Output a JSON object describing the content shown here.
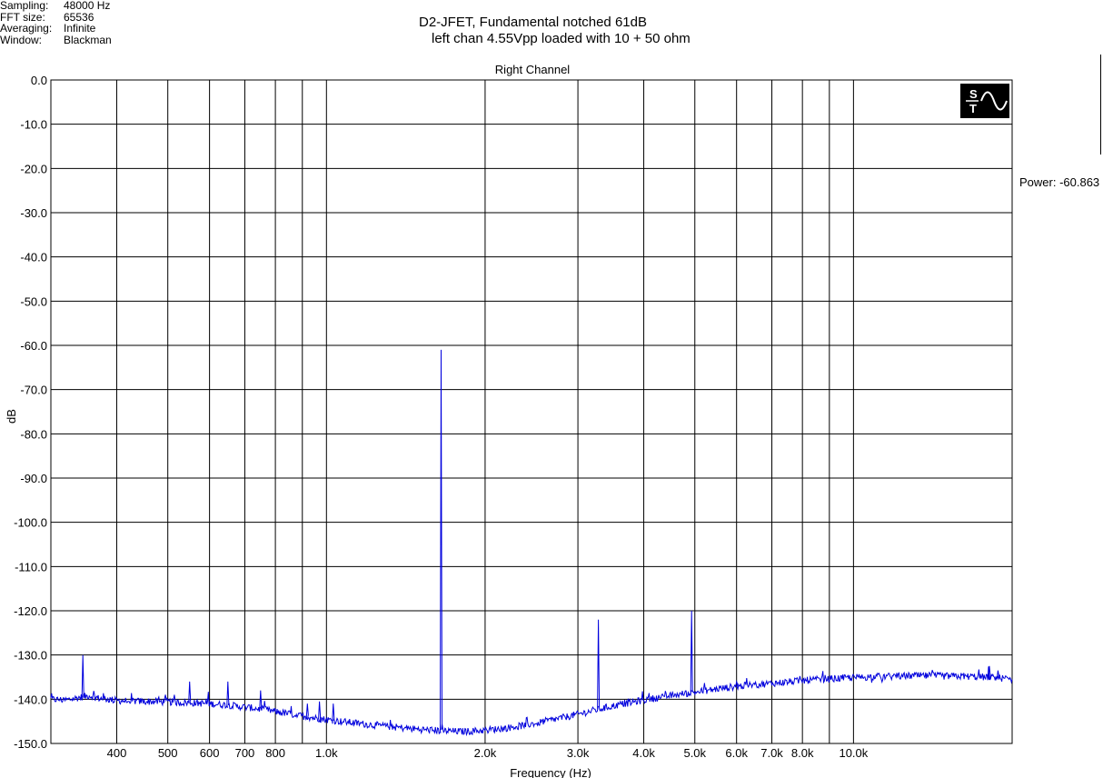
{
  "meta": {
    "rows": [
      {
        "key": "Sampling:",
        "value": "48000 Hz"
      },
      {
        "key": "FFT size:",
        "value": "65536"
      },
      {
        "key": "Averaging:",
        "value": "Infinite"
      },
      {
        "key": "Window:",
        "value": "Blackman"
      }
    ]
  },
  "header": {
    "title_line1": "D2-JFET, Fundamental notched 61dB",
    "title_line2": "left chan 4.55Vpp loaded with 10 + 50 ohm"
  },
  "power_readout": "Power: -60.863",
  "logo_text": "S T",
  "chart_data": {
    "type": "line",
    "title": "Right Channel",
    "xlabel": "Frequency (Hz)",
    "ylabel": "dB",
    "xscale": "log",
    "xlim": [
      300,
      20000
    ],
    "ylim": [
      -150,
      0
    ],
    "grid": true,
    "colors": {
      "series": "#0000dd",
      "grid": "#000000"
    },
    "y_ticks": [
      {
        "value": 0,
        "label": "0.0"
      },
      {
        "value": -10,
        "label": "-10.0"
      },
      {
        "value": -20,
        "label": "-20.0"
      },
      {
        "value": -30,
        "label": "-30.0"
      },
      {
        "value": -40,
        "label": "-40.0"
      },
      {
        "value": -50,
        "label": "-50.0"
      },
      {
        "value": -60,
        "label": "-60.0"
      },
      {
        "value": -70,
        "label": "-70.0"
      },
      {
        "value": -80,
        "label": "-80.0"
      },
      {
        "value": -90,
        "label": "-90.0"
      },
      {
        "value": -100,
        "label": "-100.0"
      },
      {
        "value": -110,
        "label": "-110.0"
      },
      {
        "value": -120,
        "label": "-120.0"
      },
      {
        "value": -130,
        "label": "-130.0"
      },
      {
        "value": -140,
        "label": "-140.0"
      },
      {
        "value": -150,
        "label": "-150.0"
      }
    ],
    "x_ticks": [
      {
        "value": 400,
        "label": "400"
      },
      {
        "value": 500,
        "label": "500"
      },
      {
        "value": 600,
        "label": "600"
      },
      {
        "value": 700,
        "label": "700"
      },
      {
        "value": 800,
        "label": "800"
      },
      {
        "value": 1000,
        "label": "1.0k"
      },
      {
        "value": 2000,
        "label": "2.0k"
      },
      {
        "value": 3000,
        "label": "3.0k"
      },
      {
        "value": 4000,
        "label": "4.0k"
      },
      {
        "value": 5000,
        "label": "5.0k"
      },
      {
        "value": 6000,
        "label": "6.0k"
      },
      {
        "value": 7000,
        "label": "7.0k"
      },
      {
        "value": 8000,
        "label": "8.0k"
      },
      {
        "value": 10000,
        "label": "10.0k"
      }
    ],
    "x_gridlines": [
      300,
      400,
      500,
      600,
      700,
      800,
      900,
      1000,
      2000,
      3000,
      4000,
      5000,
      6000,
      7000,
      8000,
      9000,
      10000,
      20000
    ],
    "series": [
      {
        "x": [
          300,
          320,
          340,
          355,
          370,
          385,
          400,
          450,
          500,
          550,
          600,
          650,
          700,
          750,
          800,
          860,
          920,
          1000,
          1100,
          1200,
          1300,
          1400,
          1500,
          1600,
          1700,
          1800,
          1900,
          2000,
          2200,
          2400,
          2700,
          3000,
          3300,
          3600,
          4000,
          4500,
          5000,
          5500,
          6000,
          7000,
          8000,
          9000,
          10000,
          11000,
          12000,
          13000,
          14000,
          15000,
          16000,
          17000,
          18000,
          19000,
          20000
        ],
        "y": [
          -140,
          -140.2,
          -139.6,
          -139.2,
          -139.8,
          -140.0,
          -140.3,
          -140.5,
          -140.6,
          -140.8,
          -141.0,
          -141.3,
          -141.8,
          -142.2,
          -142.8,
          -143.4,
          -144.0,
          -144.6,
          -145.2,
          -145.7,
          -146.1,
          -146.5,
          -146.8,
          -147.0,
          -147.2,
          -147.3,
          -147.2,
          -147.0,
          -146.5,
          -145.8,
          -144.6,
          -143.4,
          -142.2,
          -141.2,
          -140.2,
          -139.2,
          -138.4,
          -137.7,
          -137.1,
          -136.4,
          -135.8,
          -135.4,
          -135.1,
          -134.9,
          -134.8,
          -134.7,
          -134.7,
          -134.8,
          -134.8,
          -134.9,
          -135.0,
          -135.2,
          -135.5
        ],
        "peaks": [
          {
            "x": 345,
            "y": -130.0
          },
          {
            "x": 550,
            "y": -136.0
          },
          {
            "x": 650,
            "y": -136.0
          },
          {
            "x": 750,
            "y": -138.0
          },
          {
            "x": 920,
            "y": -141.0
          },
          {
            "x": 970,
            "y": -140.5
          },
          {
            "x": 1030,
            "y": -141.0
          },
          {
            "x": 1650,
            "y": -61.0
          },
          {
            "x": 3280,
            "y": -122.0
          },
          {
            "x": 4930,
            "y": -120.0
          },
          {
            "x": 6000,
            "y": -136.0
          },
          {
            "x": 18100,
            "y": -132.5
          },
          {
            "x": 18800,
            "y": -133.5
          }
        ]
      }
    ]
  }
}
